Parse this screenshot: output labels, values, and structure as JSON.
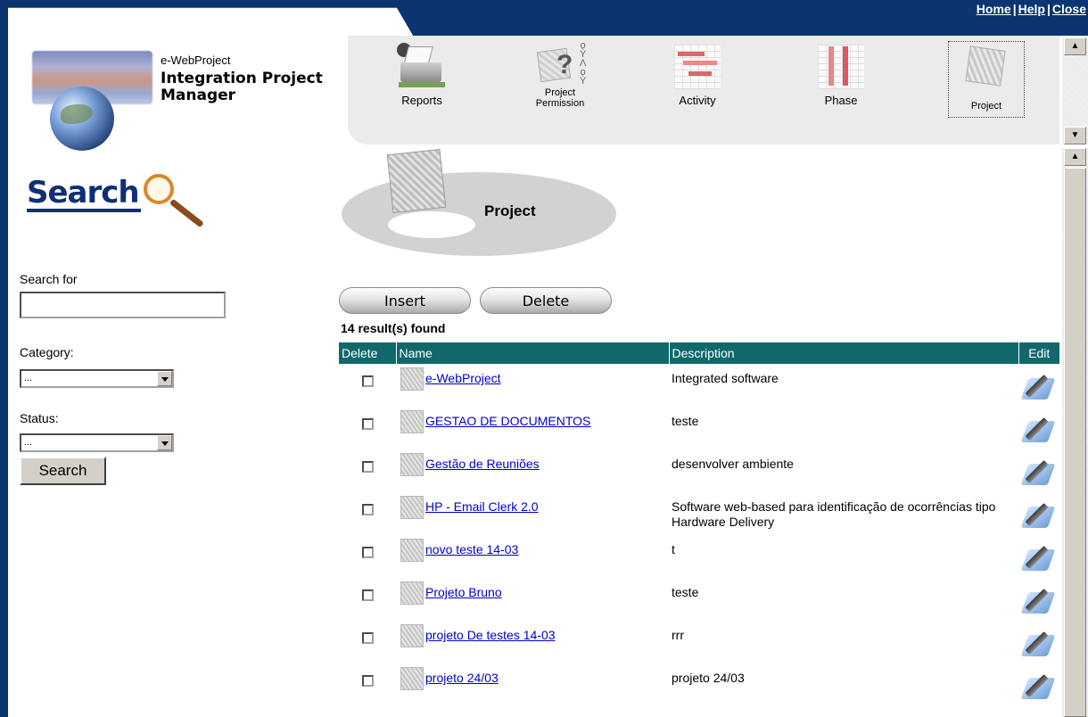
{
  "top_links": {
    "home": "Home",
    "help": "Help",
    "close": "Close",
    "separator": "|"
  },
  "brand": {
    "subtitle": "e-WebProject",
    "title_line1": "Integration Project",
    "title_line2": "Manager"
  },
  "modules": [
    {
      "label_line1": "Reports",
      "label_line2": "",
      "icon": "reports-printer-icon"
    },
    {
      "label_line1": "Project",
      "label_line2": "Permission",
      "icon": "project-permission-icon"
    },
    {
      "label_line1": "Activity",
      "label_line2": "",
      "icon": "activity-gantt-icon"
    },
    {
      "label_line1": "Phase",
      "label_line2": "",
      "icon": "phase-chart-icon"
    },
    {
      "label_line1": "Project",
      "label_line2": "",
      "icon": "project-house-icon",
      "selected": true
    }
  ],
  "search_panel": {
    "title": "Search",
    "search_for_label": "Search for",
    "search_for_value": "",
    "category_label": "Category:",
    "category_value": "...",
    "status_label": "Status:",
    "status_value": "...",
    "search_button": "Search"
  },
  "page": {
    "title": "Project"
  },
  "actions": {
    "insert": "Insert",
    "delete": "Delete"
  },
  "results_text": "14 result(s) found",
  "table": {
    "headers": {
      "delete": "Delete",
      "name": "Name",
      "description": "Description",
      "edit": "Edit"
    },
    "rows": [
      {
        "name": "e-WebProject",
        "description": "Integrated software"
      },
      {
        "name": "GESTAO DE DOCUMENTOS",
        "description": "teste"
      },
      {
        "name": "Gestão de Reuniões",
        "description": "desenvolver ambiente"
      },
      {
        "name": "HP - Email Clerk 2.0",
        "description": "Software web-based para identificação de ocorrências tipo Hardware Delivery"
      },
      {
        "name": "novo teste 14-03",
        "description": "t"
      },
      {
        "name": "Projeto Bruno",
        "description": "teste"
      },
      {
        "name": "projeto De testes 14-03",
        "description": "rrr"
      },
      {
        "name": "projeto 24/03",
        "description": "projeto 24/03"
      }
    ]
  },
  "colors": {
    "frame": "#0b3570",
    "table_header": "#10686c",
    "link": "#0000cc",
    "search_title": "#0f2f78"
  }
}
